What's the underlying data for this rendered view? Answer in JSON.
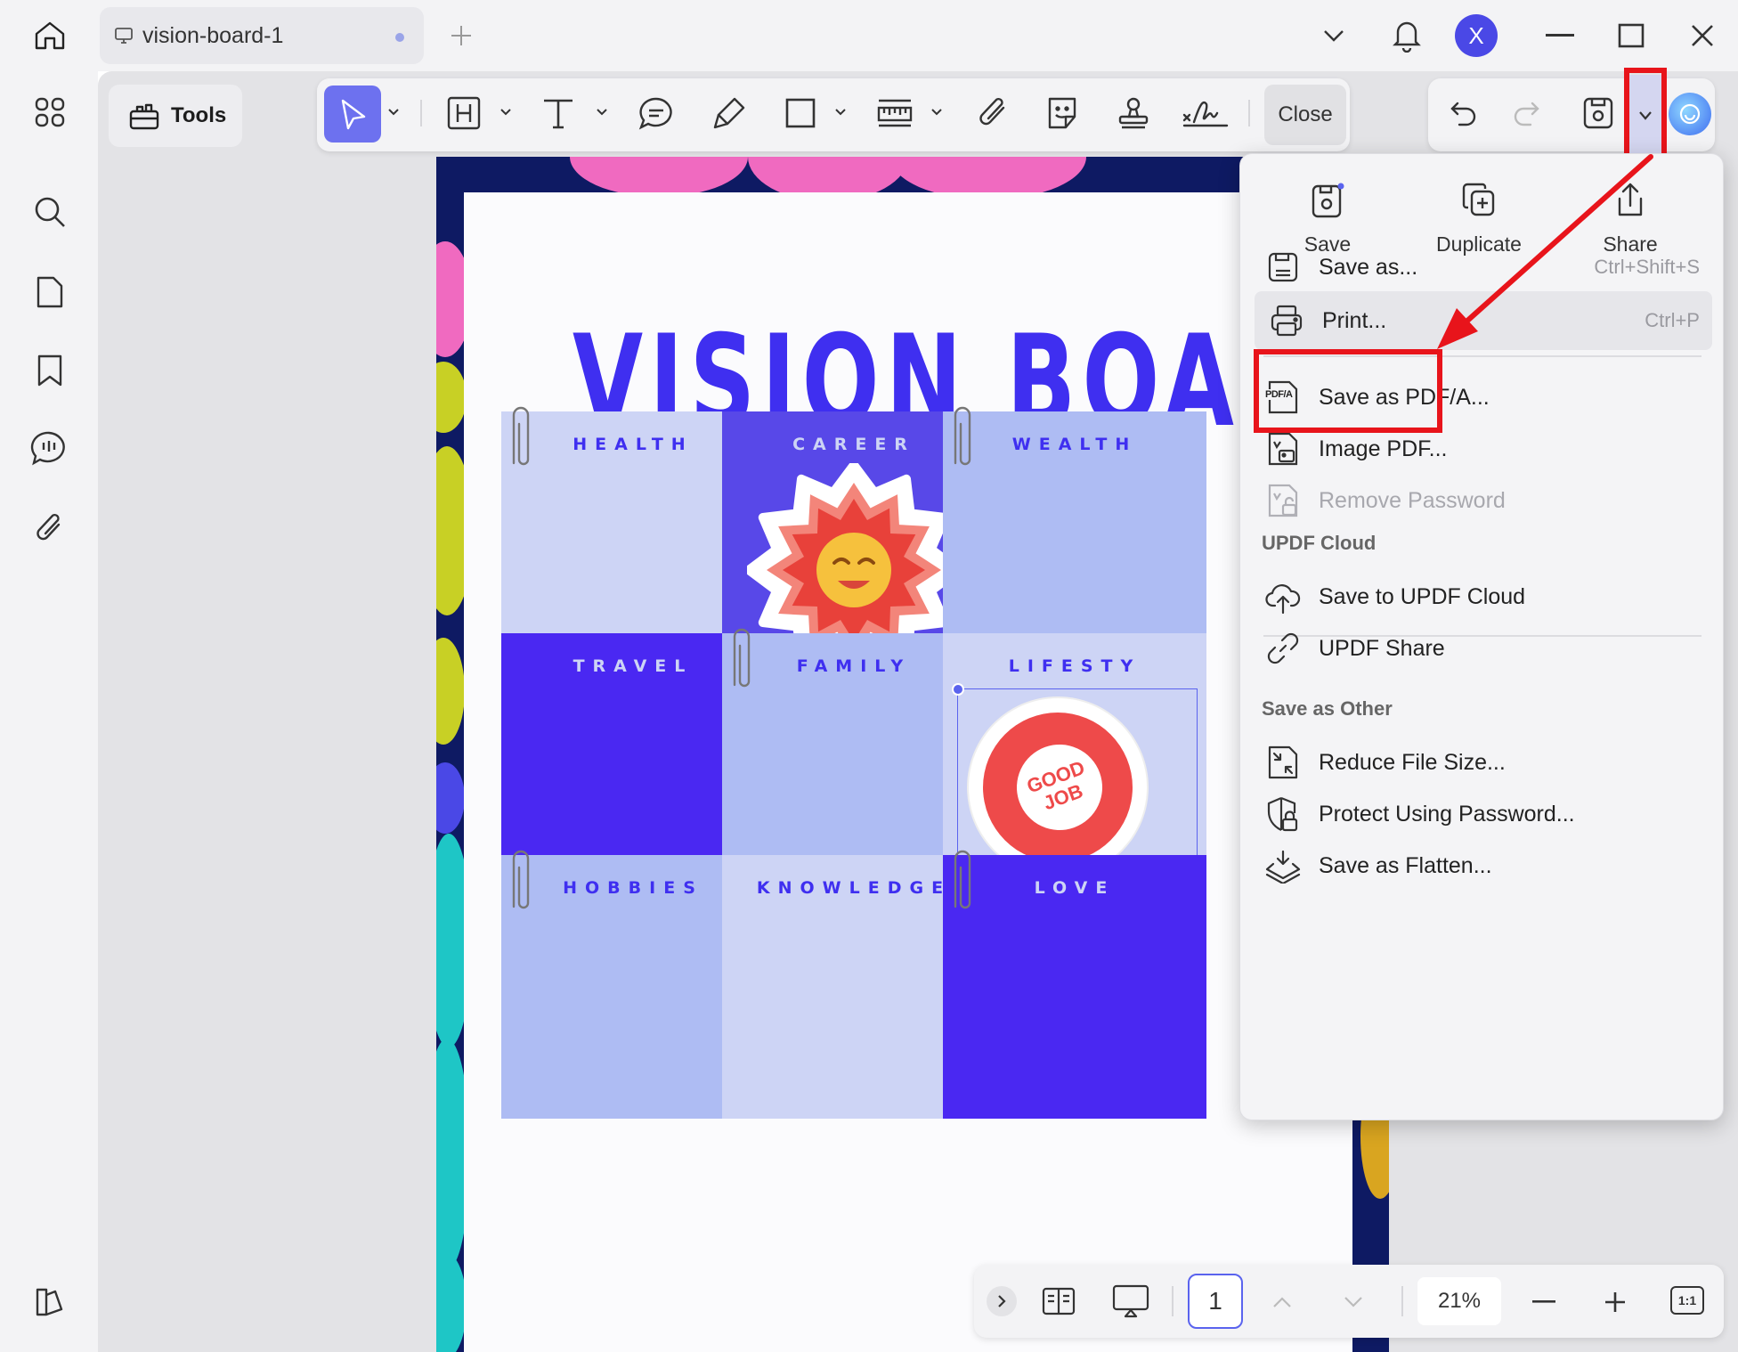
{
  "window": {
    "tab_title": "vision-board-1",
    "avatar_letter": "X"
  },
  "toolbar": {
    "tools_label": "Tools",
    "close_label": "Close"
  },
  "document": {
    "title": "VISION BOARD",
    "tiles": [
      {
        "label": "HEALTH",
        "bg": "#cdd4f5",
        "fg": "#3f2ff0"
      },
      {
        "label": "CAREER",
        "bg": "#5848e8",
        "fg": "#cdd4f5"
      },
      {
        "label": "WEALTH",
        "bg": "#aebcf3",
        "fg": "#3f2ff0"
      },
      {
        "label": "TRAVEL",
        "bg": "#4a28f2",
        "fg": "#cdd4f5"
      },
      {
        "label": "FAMILY",
        "bg": "#aebcf3",
        "fg": "#3f2ff0"
      },
      {
        "label": "LIFESTY",
        "bg": "#cdd4f5",
        "fg": "#3f2ff0"
      },
      {
        "label": "HOBBIES",
        "bg": "#aebcf3",
        "fg": "#3f2ff0"
      },
      {
        "label": "KNOWLEDGE",
        "bg": "#cdd4f5",
        "fg": "#3f2ff0"
      },
      {
        "label": "LOVE",
        "bg": "#4a28f2",
        "fg": "#cdd4f5"
      }
    ],
    "sticker_text": "GOOD JOB"
  },
  "menu": {
    "quick": [
      {
        "label": "Save",
        "icon": "save-icon"
      },
      {
        "label": "Duplicate",
        "icon": "duplicate-icon"
      },
      {
        "label": "Share",
        "icon": "share-icon"
      }
    ],
    "items": [
      {
        "label": "Save as...",
        "shortcut": "Ctrl+Shift+S",
        "icon": "save-as-icon"
      },
      {
        "label": "Print...",
        "shortcut": "Ctrl+P",
        "icon": "printer-icon"
      },
      {
        "label": "Save as PDF/A...",
        "shortcut": "",
        "icon": "pdfa-icon"
      },
      {
        "label": "Image PDF...",
        "shortcut": "",
        "icon": "image-pdf-icon"
      },
      {
        "label": "Remove Password",
        "shortcut": "",
        "icon": "remove-password-icon"
      }
    ],
    "cloud_heading": "UPDF Cloud",
    "cloud_items": [
      {
        "label": "Save to UPDF Cloud",
        "icon": "cloud-upload-icon"
      },
      {
        "label": "UPDF Share",
        "icon": "link-icon"
      }
    ],
    "other_heading": "Save as Other",
    "other_items": [
      {
        "label": "Reduce File Size...",
        "icon": "reduce-size-icon"
      },
      {
        "label": "Protect Using Password...",
        "icon": "shield-lock-icon"
      },
      {
        "label": "Save as Flatten...",
        "icon": "layers-icon"
      }
    ],
    "pdfa_icon_text": "PDF/A"
  },
  "bottombar": {
    "page_number": "1",
    "zoom": "21%",
    "fit_label": "1:1"
  },
  "colors": {
    "accent": "#6d71ef",
    "title_blue": "#3f2ff0",
    "highlight_red": "#e8141b"
  }
}
